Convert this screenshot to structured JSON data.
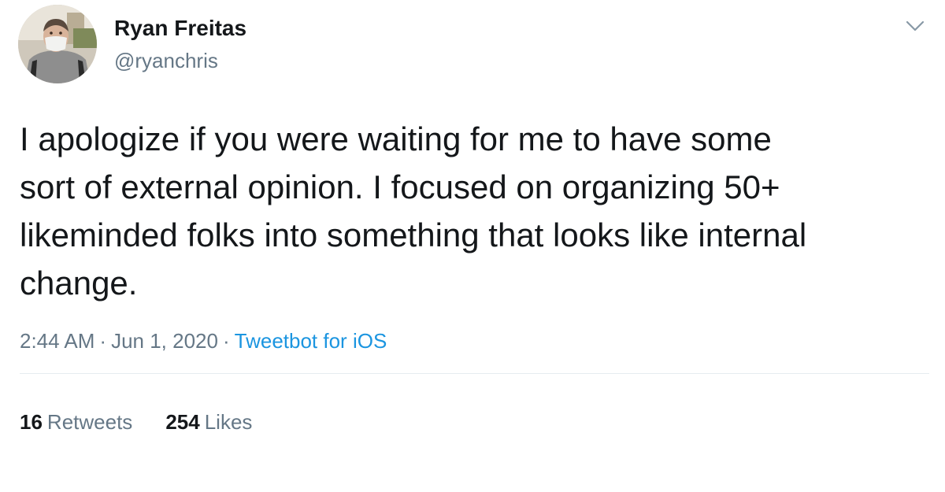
{
  "author": {
    "name": "Ryan Freitas",
    "handle": "@ryanchris",
    "avatar_icon": "profile-photo-masked-man"
  },
  "menu_icon": "chevron-down-icon",
  "tweet": {
    "text": "I apologize if you were waiting for me to have some\nsort of external opinion. I focused on organizing 50+\nlikeminded folks into something that looks like internal\nchange.",
    "time": "2:44 AM",
    "date": "Jun 1, 2020",
    "separator": "·",
    "source": "Tweetbot for iOS"
  },
  "stats": {
    "retweets_count": "16",
    "retweets_label": "Retweets",
    "likes_count": "254",
    "likes_label": "Likes"
  },
  "colors": {
    "text": "#14171a",
    "secondary": "#657786",
    "link": "#1b95e0",
    "divider": "#e6ecf0"
  }
}
